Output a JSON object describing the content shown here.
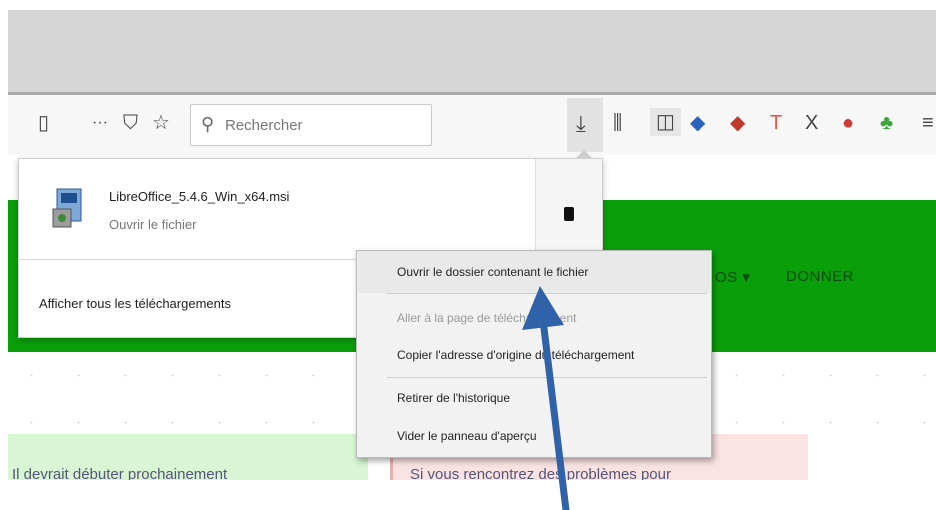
{
  "toolbar": {
    "page_icon": "page-info-icon",
    "more_label": "···",
    "search_placeholder": "Rechercher",
    "extensions": [
      "library-icon",
      "sidebar-icon",
      "extension-badge-icon",
      "extension-red-icon",
      "text-icon",
      "close-x-icon",
      "addon-icon",
      "addon-green-icon"
    ]
  },
  "downloads_panel": {
    "file_name": "LibreOffice_5.4.6_Win_x64.msi",
    "file_action": "Ouvrir le fichier",
    "show_all": "Afficher tous les téléchargements"
  },
  "context_menu": {
    "items": [
      {
        "label": "Ouvrir le dossier contenant le fichier",
        "enabled": true,
        "highlighted": true
      },
      {
        "label": "Aller à la page de téléchargement",
        "enabled": false
      },
      {
        "label": "Copier l'adresse d'origine du téléchargement",
        "enabled": true
      },
      {
        "label": "Retirer de l'historique",
        "enabled": true
      },
      {
        "label": "Vider le panneau d'aperçu",
        "enabled": true
      }
    ]
  },
  "page": {
    "nav_partial": "OS ▾",
    "nav_donate": "DONNER",
    "alert_green_text": "Il devrait débuter prochainement",
    "alert_red_text": "Si vous rencontrez des problèmes pour"
  },
  "colors": {
    "page_green": "#0b9e0b",
    "arrow_blue": "#2f62a9"
  }
}
